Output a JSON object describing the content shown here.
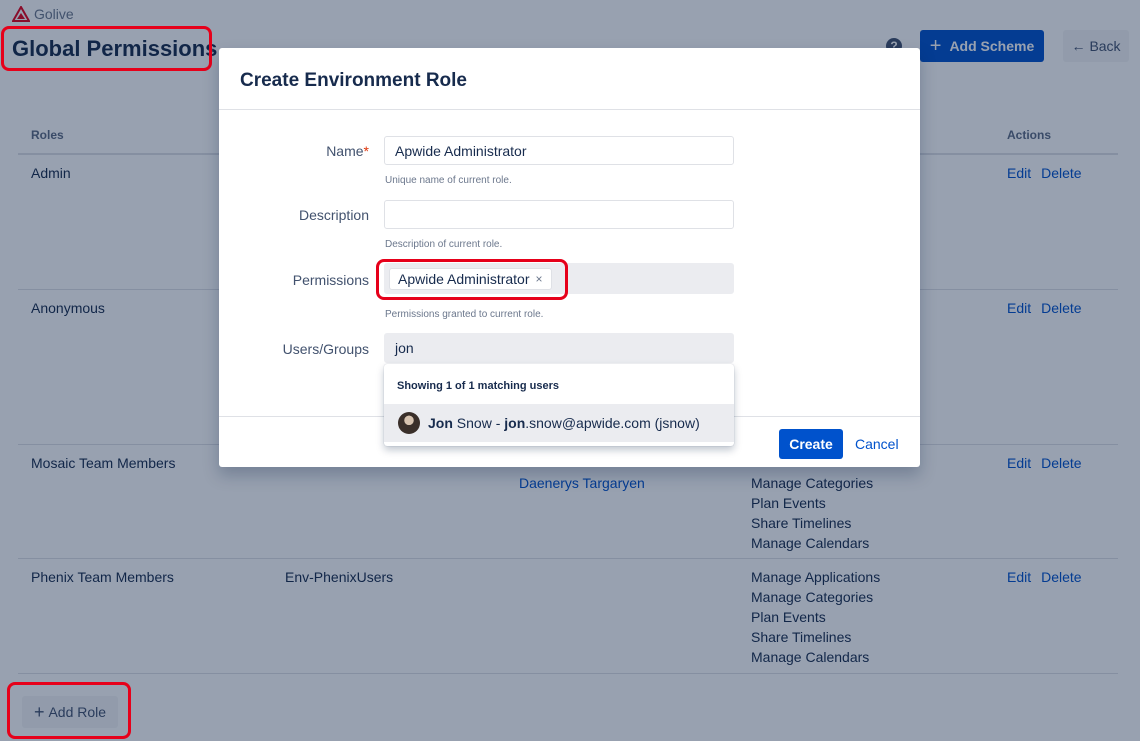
{
  "app": {
    "brand": "Golive",
    "brand_color": "#e6001a"
  },
  "header": {
    "title": "Global Permissions",
    "help": "?",
    "add_scheme_plus": "+",
    "add_scheme": "Add Scheme",
    "back_arrow": "←",
    "back": "Back"
  },
  "table": {
    "headers": {
      "roles": "Roles",
      "actions": "Actions"
    },
    "rows": [
      {
        "role": "Admin",
        "groups": "",
        "users": "",
        "permissions": [],
        "edit": "Edit",
        "delete": "Delete"
      },
      {
        "role": "Anonymous",
        "groups": "",
        "users": "",
        "permissions": [],
        "edit": "Edit",
        "delete": "Delete"
      },
      {
        "role": "Mosaic Team Members",
        "groups": "",
        "users": "Daenerys Targaryen",
        "permissions": [
          "Manage Categories",
          "Plan Events",
          "Share Timelines",
          "Manage Calendars"
        ],
        "edit": "Edit",
        "delete": "Delete"
      },
      {
        "role": "Phenix Team Members",
        "groups": "Env-PhenixUsers",
        "users": "",
        "permissions": [
          "Manage Applications",
          "Manage Categories",
          "Plan Events",
          "Share Timelines",
          "Manage Calendars"
        ],
        "edit": "Edit",
        "delete": "Delete"
      }
    ]
  },
  "add_role": {
    "plus": "+",
    "label": "Add Role"
  },
  "dialog": {
    "title": "Create Environment Role",
    "name": {
      "label": "Name",
      "required_mark": "*",
      "value": "Apwide Administrator",
      "help": "Unique name of current role."
    },
    "description": {
      "label": "Description",
      "value": "",
      "help": "Description of current role."
    },
    "permissions": {
      "label": "Permissions",
      "chip": "Apwide Administrator",
      "chip_remove": "×",
      "help": "Permissions granted to current role."
    },
    "users_groups": {
      "label": "Users/Groups",
      "value": "jon",
      "dropdown_header": "Showing 1 of 1 matching users",
      "match": {
        "first_bold": "Jon",
        "first_rest": " Snow - ",
        "email_bold": "jon",
        "email_rest": ".snow@apwide.com (jsnow)"
      }
    },
    "create": "Create",
    "cancel": "Cancel"
  },
  "colors": {
    "primary": "#0052cc",
    "highlight": "#e6001a",
    "required": "#de350b"
  }
}
